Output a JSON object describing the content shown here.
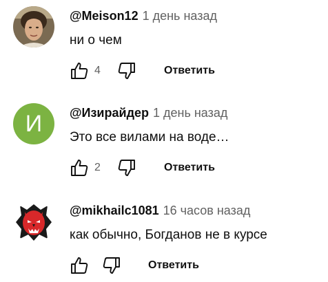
{
  "comments": [
    {
      "author": "@Meison12",
      "time": "1 день назад",
      "text": "ни о чем",
      "likes": "4",
      "reply": "Ответить",
      "avatar": "photo-avatar"
    },
    {
      "author": "@Изирайдер",
      "time": "1 день назад",
      "text": "Это все вилами на воде…",
      "likes": "2",
      "reply": "Ответить",
      "avatar_letter": "И",
      "avatar_color": "#7cb342"
    },
    {
      "author": "@mikhailc1081",
      "time": "16 часов назад",
      "text": "как обычно, Богданов не в курсе",
      "likes": "",
      "reply": "Ответить",
      "avatar": "red-devil-logo-avatar"
    }
  ],
  "icons": {
    "like": "thumbs-up-icon",
    "dislike": "thumbs-down-icon"
  },
  "colors": {
    "primary_text": "#0f0f0f",
    "secondary_text": "#606060",
    "letter_avatar_bg": "#7cb342"
  }
}
